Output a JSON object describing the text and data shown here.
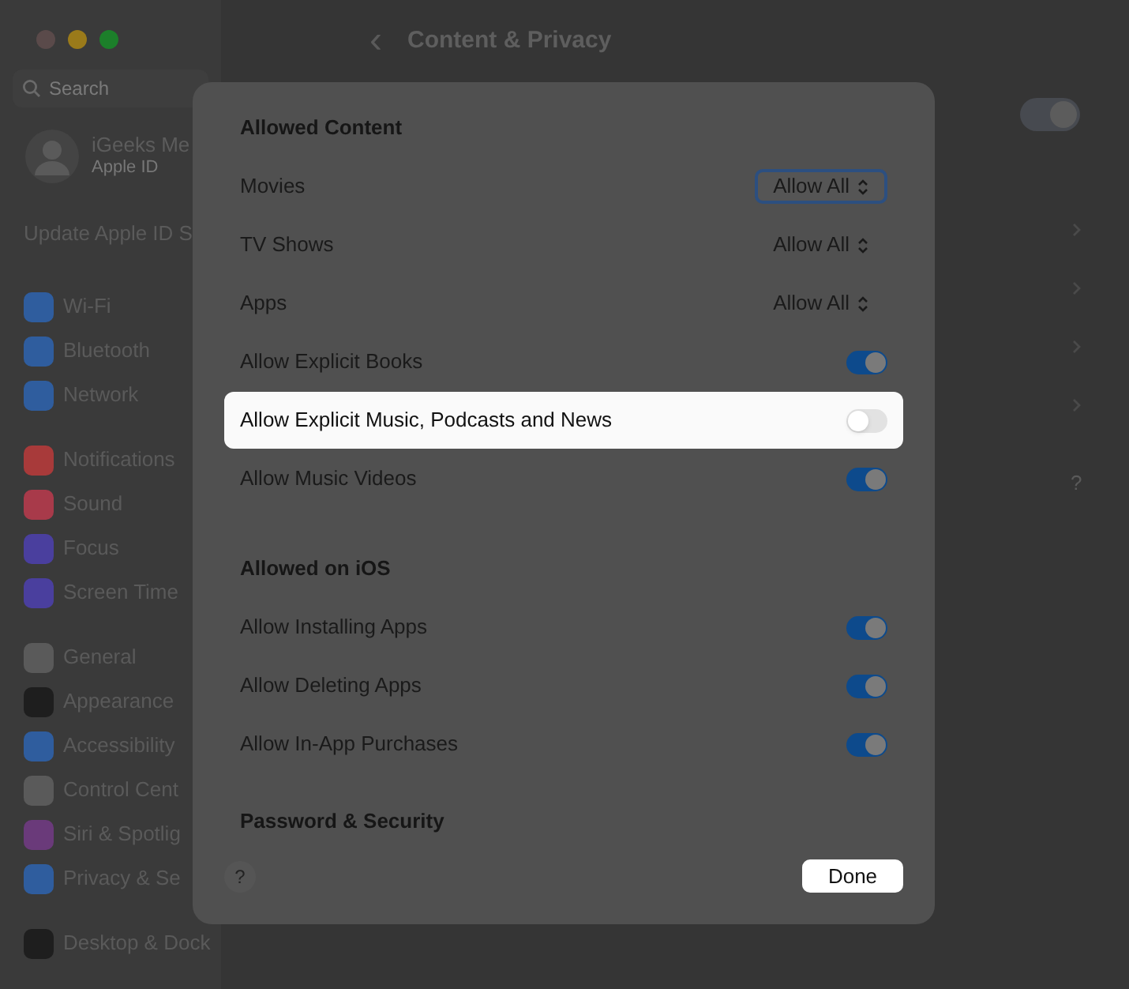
{
  "window": {
    "title": "Content & Privacy",
    "back": "‹"
  },
  "sidebar": {
    "search": {
      "placeholder": "Search"
    },
    "account": {
      "name": "iGeeks Me",
      "subtitle": "Apple ID"
    },
    "notice": "Update Apple ID S",
    "groups": [
      [
        {
          "label": "Wi-Fi",
          "color": "#2f5d9e"
        },
        {
          "label": "Bluetooth",
          "color": "#2f5d9e"
        },
        {
          "label": "Network",
          "color": "#2f5d9e"
        }
      ],
      [
        {
          "label": "Notifications",
          "color": "#a83a3a"
        },
        {
          "label": "Sound",
          "color": "#a83a4a"
        },
        {
          "label": "Focus",
          "color": "#4a3f9e"
        },
        {
          "label": "Screen Time",
          "color": "#4a3f9e"
        }
      ],
      [
        {
          "label": "General",
          "color": "#5a5a5a"
        },
        {
          "label": "Appearance",
          "color": "#1e1e1e"
        },
        {
          "label": "Accessibility",
          "color": "#2f5d9e"
        },
        {
          "label": "Control Cent",
          "color": "#5a5a5a"
        },
        {
          "label": "Siri & Spotlig",
          "color": "#6a3a7a"
        },
        {
          "label": "Privacy & Se",
          "color": "#2f5d9e"
        }
      ],
      [
        {
          "label": "Desktop & Dock",
          "color": "#1e1e1e"
        }
      ]
    ]
  },
  "background_panel": {
    "toggle_on": true,
    "help": "?"
  },
  "sheet": {
    "sections": [
      {
        "title": "Allowed Content",
        "rows": [
          {
            "kind": "popup",
            "label": "Movies",
            "value": "Allow All",
            "focused": true,
            "highlighted": false
          },
          {
            "kind": "popup",
            "label": "TV Shows",
            "value": "Allow All",
            "focused": false,
            "highlighted": false
          },
          {
            "kind": "popup",
            "label": "Apps",
            "value": "Allow All",
            "focused": false,
            "highlighted": false
          },
          {
            "kind": "toggle",
            "label": "Allow Explicit Books",
            "on": true,
            "highlighted": false
          },
          {
            "kind": "toggle",
            "label": "Allow Explicit Music, Podcasts and News",
            "on": false,
            "highlighted": true
          },
          {
            "kind": "toggle",
            "label": "Allow Music Videos",
            "on": true,
            "highlighted": false
          }
        ]
      },
      {
        "title": "Allowed on iOS",
        "rows": [
          {
            "kind": "toggle",
            "label": "Allow Installing Apps",
            "on": true,
            "highlighted": false
          },
          {
            "kind": "toggle",
            "label": "Allow Deleting Apps",
            "on": true,
            "highlighted": false
          },
          {
            "kind": "toggle",
            "label": "Allow In-App Purchases",
            "on": true,
            "highlighted": false
          }
        ]
      },
      {
        "title": "Password & Security"
      }
    ],
    "help": "?",
    "done": "Done"
  }
}
